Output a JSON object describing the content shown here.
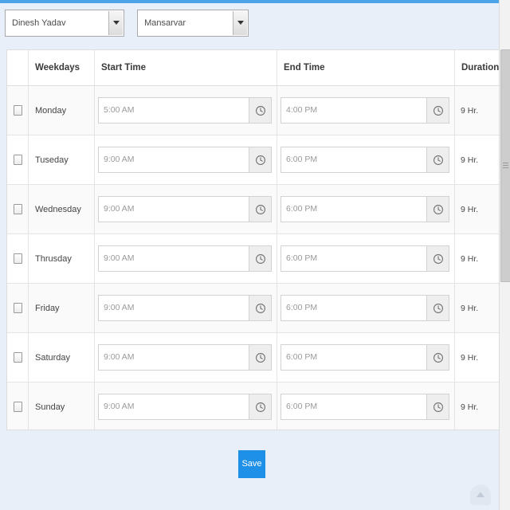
{
  "theme": {
    "accent_bar": "#4da3e8",
    "save_button_bg": "#1e90e8",
    "page_bg": "#e9eff8",
    "panel_bg": "#ffffff"
  },
  "filters": {
    "employee_select": {
      "value": "Dinesh Yadav",
      "caret_icon": "chevron-down-icon"
    },
    "location_select": {
      "value": "Mansarvar",
      "caret_icon": "chevron-down-icon"
    }
  },
  "table": {
    "columns": {
      "select": "",
      "weekdays": "Weekdays",
      "start_time": "Start Time",
      "end_time": "End Time",
      "duration": "Duration"
    },
    "rows": [
      {
        "day": "Monday",
        "start": "5:00 AM",
        "end": "4:00 PM",
        "duration": "9 Hr."
      },
      {
        "day": "Tuseday",
        "start": "9:00 AM",
        "end": "6:00 PM",
        "duration": "9 Hr."
      },
      {
        "day": "Wednesday",
        "start": "9:00 AM",
        "end": "6:00 PM",
        "duration": "9 Hr."
      },
      {
        "day": "Thrusday",
        "start": "9:00 AM",
        "end": "6:00 PM",
        "duration": "9 Hr."
      },
      {
        "day": "Friday",
        "start": "9:00 AM",
        "end": "6:00 PM",
        "duration": "9 Hr."
      },
      {
        "day": "Saturday",
        "start": "9:00 AM",
        "end": "6:00 PM",
        "duration": "9 Hr."
      },
      {
        "day": "Sunday",
        "start": "9:00 AM",
        "end": "6:00 PM",
        "duration": "9 Hr."
      }
    ],
    "time_picker_icon": "clock-icon"
  },
  "actions": {
    "save_label": "Save"
  },
  "scroll_top": {
    "icon": "arrow-up-icon"
  }
}
